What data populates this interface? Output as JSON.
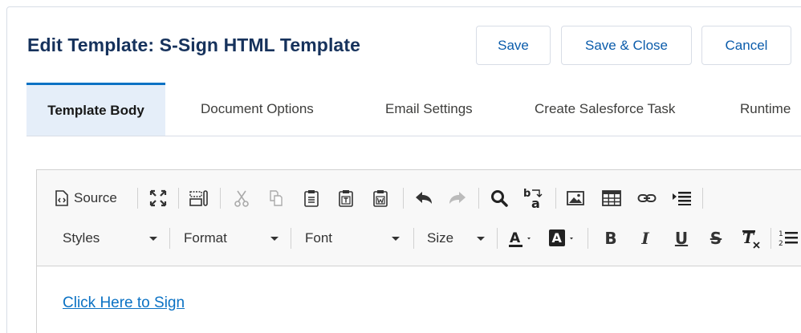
{
  "header": {
    "title": "Edit Template: S-Sign HTML Template",
    "save_label": "Save",
    "save_close_label": "Save & Close",
    "cancel_label": "Cancel"
  },
  "tabs": [
    {
      "label": "Template Body",
      "active": true
    },
    {
      "label": "Document Options",
      "active": false
    },
    {
      "label": "Email Settings",
      "active": false
    },
    {
      "label": "Create Salesforce Task",
      "active": false
    },
    {
      "label": "Runtime",
      "active": false
    }
  ],
  "toolbar": {
    "source_label": "Source",
    "icons_row1": [
      "source-icon",
      "maximize-icon",
      "show-blocks-icon",
      "cut-icon",
      "copy-icon",
      "paste-icon",
      "paste-text-icon",
      "paste-word-icon",
      "undo-icon",
      "redo-icon",
      "find-icon",
      "replace-icon",
      "image-icon",
      "table-icon",
      "link-icon",
      "page-break-icon"
    ],
    "styles_label": "Styles",
    "format_label": "Format",
    "font_label": "Font",
    "size_label": "Size",
    "icons_row2": [
      "text-color-icon",
      "background-color-icon",
      "bold-icon",
      "italic-icon",
      "underline-icon",
      "strikethrough-icon",
      "remove-format-icon",
      "numbered-list-icon"
    ]
  },
  "content": {
    "link_text": "Click Here to Sign"
  },
  "colors": {
    "title": "#16325c",
    "button_text": "#0b5cab",
    "active_tab_bg": "#e5eef9",
    "active_tab_border": "#0b72c4",
    "link": "#0b72c4"
  }
}
